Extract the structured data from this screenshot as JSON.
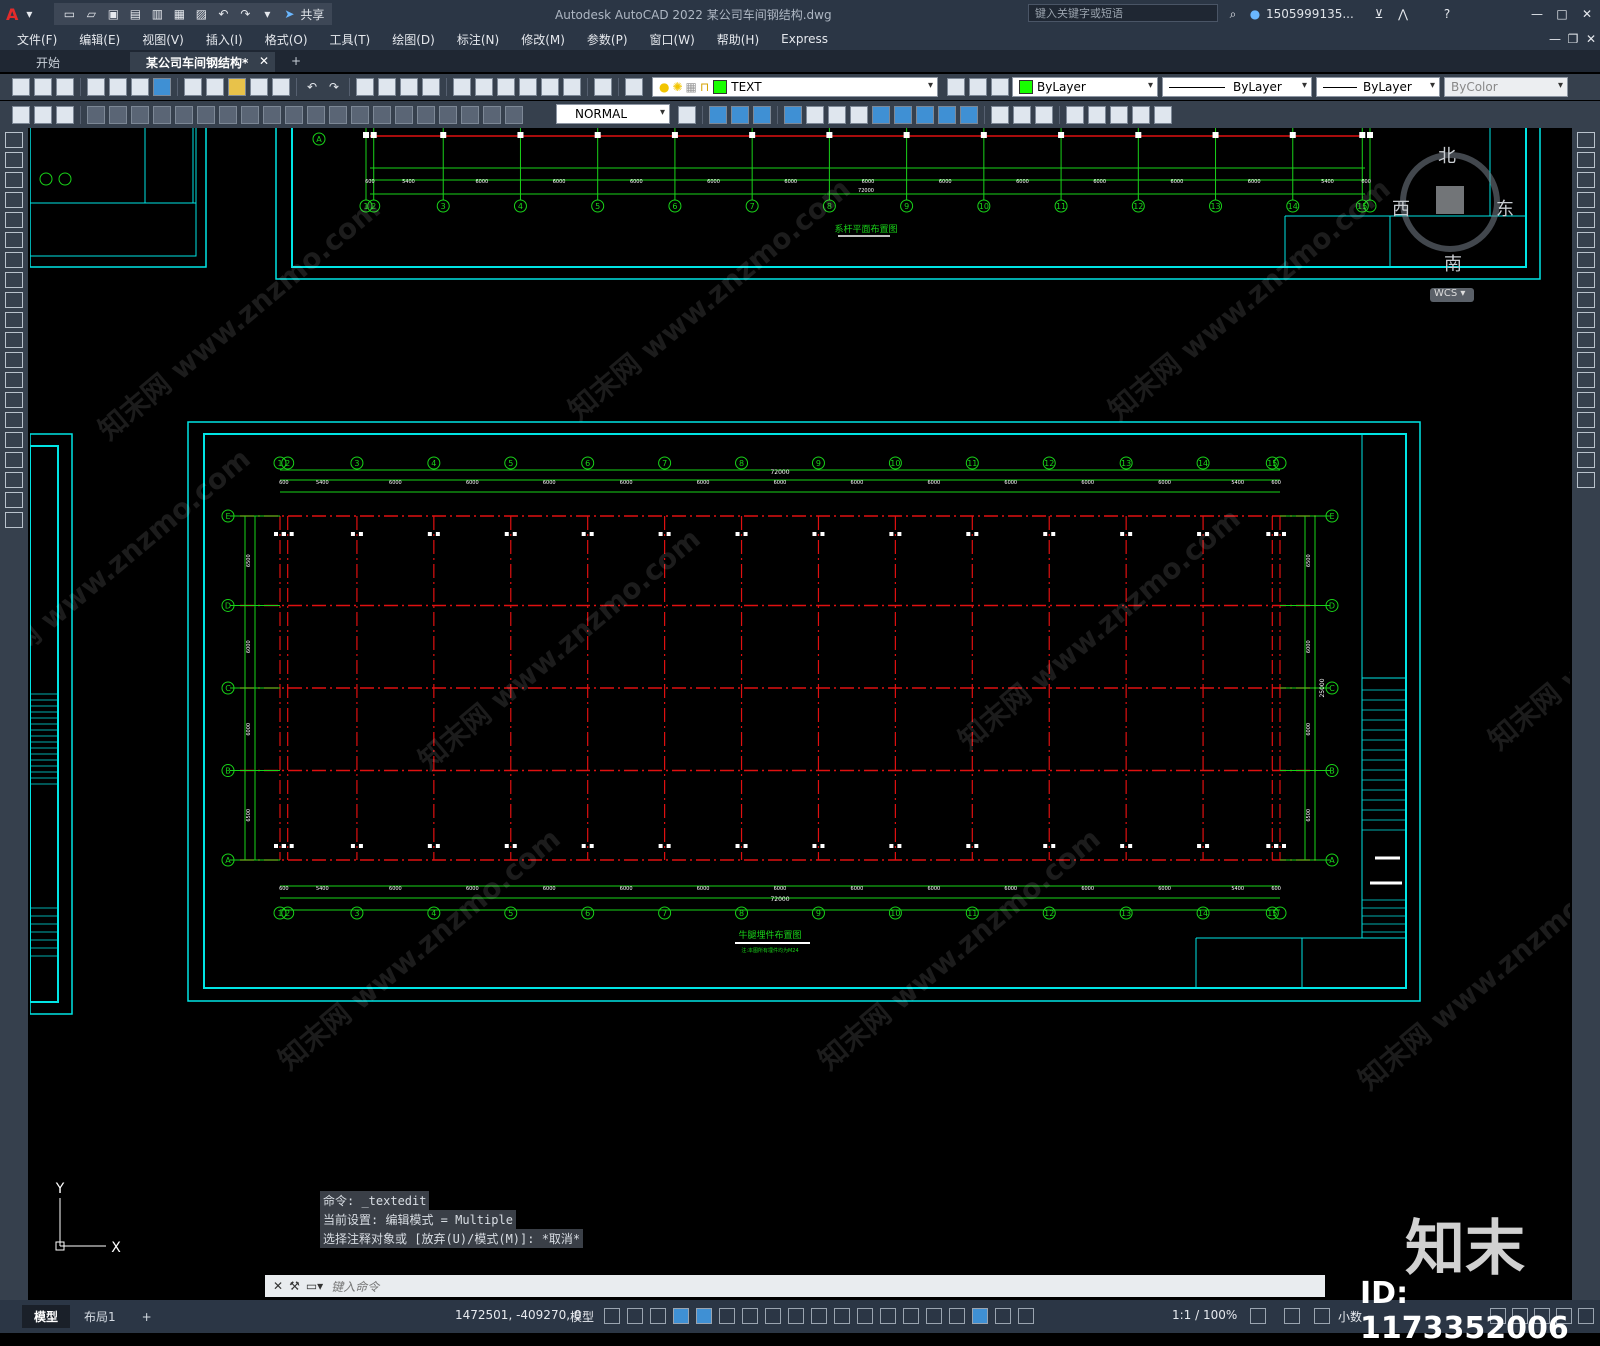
{
  "window": {
    "title": "Autodesk AutoCAD 2022    某公司车间钢结构.dwg",
    "share_label": "共享",
    "search_placeholder": "键入关键字或短语",
    "user": "1505999135..."
  },
  "menu": [
    "文件(F)",
    "编辑(E)",
    "视图(V)",
    "插入(I)",
    "格式(O)",
    "工具(T)",
    "绘图(D)",
    "标注(N)",
    "修改(M)",
    "参数(P)",
    "窗口(W)",
    "帮助(H)",
    "Express"
  ],
  "tabs": [
    {
      "label": "开始",
      "active": false
    },
    {
      "label": "某公司车间钢结构*",
      "active": true
    }
  ],
  "layer": {
    "name": "TEXT",
    "color": "#18ff00"
  },
  "properties": {
    "color": "ByLayer",
    "linetype": "ByLayer",
    "lineweight": "ByLayer",
    "plotstyle": "ByColor"
  },
  "textstyle": "NORMAL",
  "viewcube": {
    "north": "北",
    "west": "西",
    "east": "东",
    "south": "南",
    "ucs": "WCS"
  },
  "drawing": {
    "top_title": "系杆平面布置图",
    "main_title": "牛腿埋件布置图",
    "main_subtitle": "注:本图所有埋件均为M24",
    "total_dimension": "72000",
    "height_dimension": "25000",
    "grid_numbers": [
      "1",
      "2",
      "3",
      "4",
      "5",
      "6",
      "7",
      "8",
      "9",
      "10",
      "11",
      "12",
      "13",
      "14",
      "15"
    ],
    "grid_letters": [
      "E",
      "D",
      "C",
      "B",
      "A"
    ],
    "bay_dims": [
      "600",
      "5400",
      "6000",
      "6000",
      "6000",
      "6000",
      "6000",
      "6000",
      "6000",
      "6000",
      "6000",
      "6000",
      "6000",
      "5400",
      "600"
    ],
    "row_dims": [
      "6500",
      "6000",
      "6000",
      "6500"
    ]
  },
  "command": {
    "history": [
      "命令: _textedit",
      "当前设置: 编辑模式 = Multiple",
      "选择注释对象或 [放弃(U)/模式(M)]: *取消*"
    ],
    "placeholder": "键入命令"
  },
  "status": {
    "layouts": [
      {
        "label": "模型",
        "active": true
      },
      {
        "label": "布局1",
        "active": false
      }
    ],
    "coordinates": "1472501, -409270, 0",
    "model_label": "模型",
    "scale": "1:1 / 100%",
    "units": "小数"
  },
  "watermarks": {
    "text": "知末网 www.znzmo.com",
    "logo": "知末",
    "id": "ID: 1173352006"
  },
  "colors": {
    "frame": "#00e5e5",
    "grid_green": "#19d319",
    "axis_red": "#e01010",
    "white": "#ffffff"
  }
}
